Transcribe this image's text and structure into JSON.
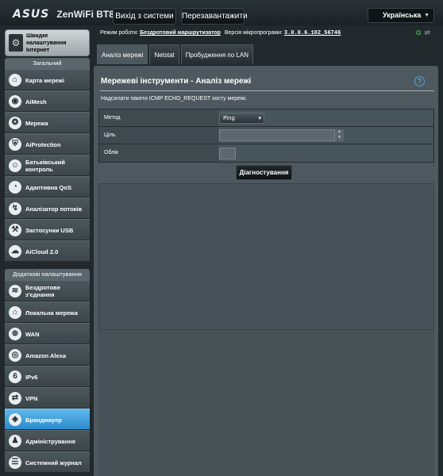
{
  "header": {
    "brand": "ASUS",
    "model": "ZenWiFi BT8",
    "logout_label": "Вихід з системи",
    "reboot_label": "Перезавантажити",
    "language": "Українська"
  },
  "status": {
    "mode_label": "Режим роботи:",
    "mode_value": "Бездротовий маршрутизатор",
    "firmware_label": "Версія мікропрограми:",
    "firmware_value": "3.0.0.6.102_56746",
    "icons": [
      "network-status-icon",
      "usb-status-icon"
    ]
  },
  "sidebar": {
    "quick_setup": "Швидке налаштування Інтернет",
    "general_header": "Загальний",
    "general_items": [
      {
        "label": "Карта мережі",
        "icon": "network-map-icon"
      },
      {
        "label": "AiMesh",
        "icon": "aimesh-icon"
      },
      {
        "label": "Мережа",
        "icon": "network-icon"
      },
      {
        "label": "AiProtection",
        "icon": "aiprotection-icon"
      },
      {
        "label": "Батьківський контроль",
        "icon": "parental-control-icon"
      },
      {
        "label": "Адаптивна QoS",
        "icon": "qos-icon"
      },
      {
        "label": "Аналізатор потоків",
        "icon": "traffic-analyzer-icon"
      },
      {
        "label": "Застосунки USB",
        "icon": "usb-apps-icon"
      },
      {
        "label": "AiCloud 2.0",
        "icon": "aicloud-icon"
      }
    ],
    "advanced_header": "Додаткові налаштування",
    "advanced_items": [
      {
        "label": "Бездротове з'єднання",
        "icon": "wireless-icon"
      },
      {
        "label": "Локальна мережа",
        "icon": "lan-icon"
      },
      {
        "label": "WAN",
        "icon": "wan-icon"
      },
      {
        "label": "Amazon Alexa",
        "icon": "alexa-icon"
      },
      {
        "label": "IPv6",
        "icon": "ipv6-icon"
      },
      {
        "label": "VPN",
        "icon": "vpn-icon"
      },
      {
        "label": "Брандмауер",
        "icon": "firewall-icon"
      },
      {
        "label": "Адміністрування",
        "icon": "administration-icon"
      },
      {
        "label": "Системний журнал",
        "icon": "system-log-icon"
      }
    ],
    "active_item": "Брандмауер"
  },
  "tabs": [
    "Аналіз мережі",
    "Netstat",
    "Пробудження по LAN"
  ],
  "active_tab": "Аналіз мережі",
  "panel": {
    "title": "Мережеві інструменти - Аналіз мережі",
    "description": "Надсилати пакети ICMP ECHO_REQUEST хосту мережі.",
    "method_label": "Метод",
    "method_value": "Ping",
    "target_label": "Ціль",
    "target_placeholder": "",
    "count_label": "Облік",
    "count_value": "",
    "diagnose_button": "Діагностування",
    "result_text": ""
  }
}
